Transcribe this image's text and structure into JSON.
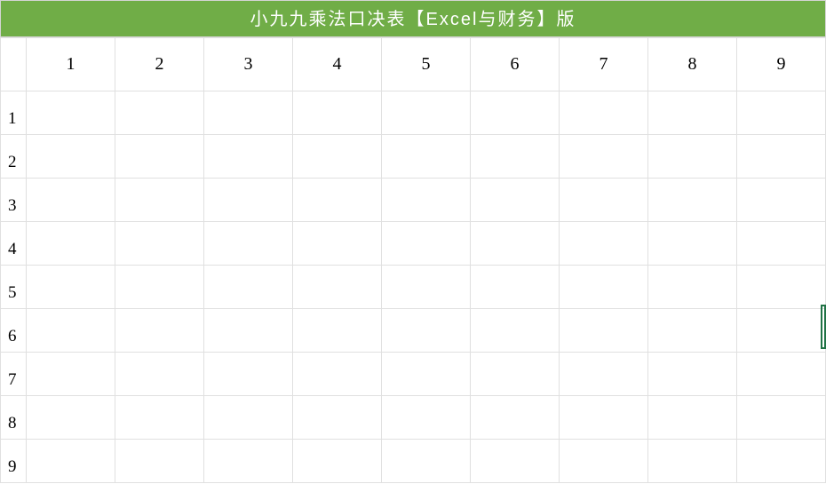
{
  "title": "小九九乘法口决表【Excel与财务】版",
  "colors": {
    "header_bg": "#70ad47",
    "header_fg": "#ffffff",
    "grid_line": "#e0e0e0",
    "selection": "#217346"
  },
  "columns": [
    "1",
    "2",
    "3",
    "4",
    "5",
    "6",
    "7",
    "8",
    "9"
  ],
  "rows": [
    "1",
    "2",
    "3",
    "4",
    "5",
    "6",
    "7",
    "8",
    "9"
  ],
  "cells": {
    "r1": [
      "",
      "",
      "",
      "",
      "",
      "",
      "",
      "",
      ""
    ],
    "r2": [
      "",
      "",
      "",
      "",
      "",
      "",
      "",
      "",
      ""
    ],
    "r3": [
      "",
      "",
      "",
      "",
      "",
      "",
      "",
      "",
      ""
    ],
    "r4": [
      "",
      "",
      "",
      "",
      "",
      "",
      "",
      "",
      ""
    ],
    "r5": [
      "",
      "",
      "",
      "",
      "",
      "",
      "",
      "",
      ""
    ],
    "r6": [
      "",
      "",
      "",
      "",
      "",
      "",
      "",
      "",
      ""
    ],
    "r7": [
      "",
      "",
      "",
      "",
      "",
      "",
      "",
      "",
      ""
    ],
    "r8": [
      "",
      "",
      "",
      "",
      "",
      "",
      "",
      "",
      ""
    ],
    "r9": [
      "",
      "",
      "",
      "",
      "",
      "",
      "",
      "",
      ""
    ]
  }
}
